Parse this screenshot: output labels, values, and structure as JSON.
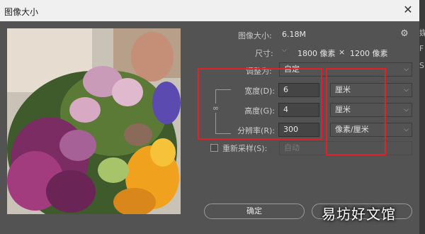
{
  "window": {
    "title": "图像大小",
    "close_glyph": "✕"
  },
  "right_strip": {
    "fragments": [
      "媒",
      "F",
      "S"
    ]
  },
  "info": {
    "image_size_label": "图像大小:",
    "image_size_value": "6.18M",
    "dimensions_label": "尺寸:",
    "dimensions_width": "1800 像素",
    "dimensions_times": "×",
    "dimensions_height": "1200 像素",
    "fit_to_label": "调整为:",
    "fit_to_value": "自定"
  },
  "fields": {
    "width_label": "宽度(D):",
    "width_value": "6",
    "width_unit": "厘米",
    "height_label": "高度(G):",
    "height_value": "4",
    "height_unit": "厘米",
    "resolution_label": "分辨率(R):",
    "resolution_value": "300",
    "resolution_unit": "像素/厘米"
  },
  "resample": {
    "label": "重新采样(S):",
    "value": "自动",
    "checked": false
  },
  "buttons": {
    "ok_label": "确定"
  },
  "watermark": "易坊好文馆",
  "colors": {
    "highlight_box": "#e0212a",
    "dialog_bg": "#535353",
    "titlebar_bg": "#f0f0f0"
  }
}
